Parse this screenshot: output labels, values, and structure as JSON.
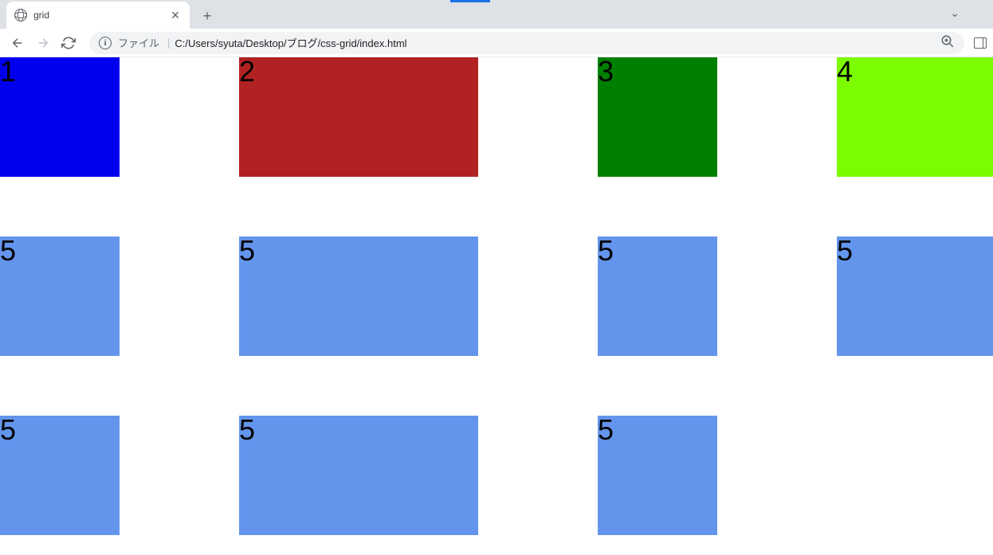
{
  "browser": {
    "tab_title": "grid",
    "address_label": "ファイル",
    "url": "C:/Users/syuta/Desktop/ブログ/css-grid/index.html"
  },
  "grid": {
    "cells": [
      {
        "label": "1",
        "colorClass": "c-blue"
      },
      {
        "label": "2",
        "colorClass": "c-brown"
      },
      {
        "label": "3",
        "colorClass": "c-green"
      },
      {
        "label": "4",
        "colorClass": "c-lime"
      },
      {
        "label": "5",
        "colorClass": "c-cornflower"
      },
      {
        "label": "5",
        "colorClass": "c-cornflower"
      },
      {
        "label": "5",
        "colorClass": "c-cornflower"
      },
      {
        "label": "5",
        "colorClass": "c-cornflower"
      },
      {
        "label": "5",
        "colorClass": "c-cornflower"
      },
      {
        "label": "5",
        "colorClass": "c-cornflower"
      },
      {
        "label": "5",
        "colorClass": "c-cornflower"
      }
    ]
  }
}
